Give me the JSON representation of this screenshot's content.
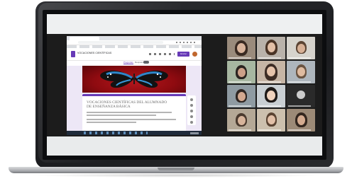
{
  "browser": {
    "forms_title": "VOCACIONES CIENTÍFICAS",
    "send_label": "Enviar",
    "subtabs": [
      "Preguntas",
      "Respuestas"
    ],
    "form_title": "VOCACIONES CIENTÍFICAS DEL ALUMNADO DE ENSEÑANZA BÁSICA"
  },
  "participants": [
    {
      "id": "p1"
    },
    {
      "id": "p2"
    },
    {
      "id": "p3"
    },
    {
      "id": "p4"
    },
    {
      "id": "p5"
    },
    {
      "id": "p6"
    },
    {
      "id": "p7"
    },
    {
      "id": "p8"
    },
    {
      "id": "p9"
    },
    {
      "id": "p10"
    },
    {
      "id": "p11"
    },
    {
      "id": "p12"
    }
  ],
  "colors": {
    "forms_accent": "#673ab7",
    "zoom_background": "#1c1c1c",
    "laptop_frame": "#1f2022"
  }
}
